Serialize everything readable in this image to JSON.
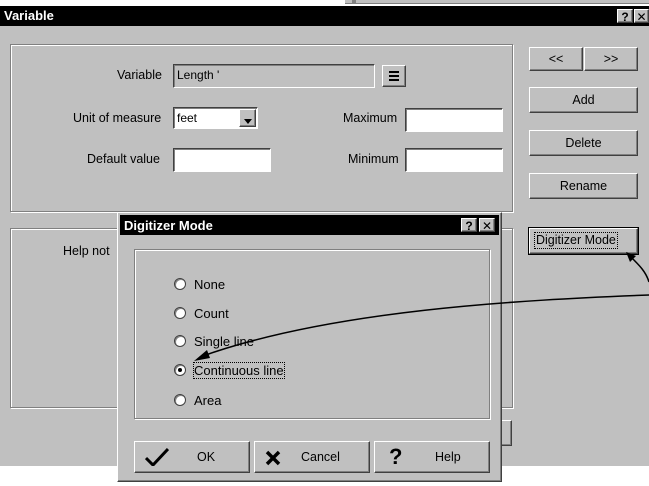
{
  "variable_dialog": {
    "title": "Variable",
    "help_button": "?",
    "close_button": "✕",
    "variable_label": "Variable",
    "variable_value": "Length '",
    "unit_label": "Unit of measure",
    "unit_value": "feet",
    "maximum_label": "Maximum",
    "default_label": "Default value",
    "minimum_label": "Minimum",
    "help_notes_label": "Help not",
    "prev_label": "<<",
    "next_label": ">>",
    "add_label": "Add",
    "delete_label": "Delete",
    "rename_label": "Rename",
    "digitizer_mode_label": "Digitizer Mode"
  },
  "digitizer_dialog": {
    "title": "Digitizer Mode",
    "help_button": "?",
    "close_button": "✕",
    "options": [
      {
        "label": "None",
        "selected": false
      },
      {
        "label": "Count",
        "selected": false
      },
      {
        "label": "Single line",
        "selected": false
      },
      {
        "label": "Continuous line",
        "selected": true
      },
      {
        "label": "Area",
        "selected": false
      }
    ],
    "ok_label": "OK",
    "cancel_label": "Cancel",
    "help_label": "Help"
  }
}
